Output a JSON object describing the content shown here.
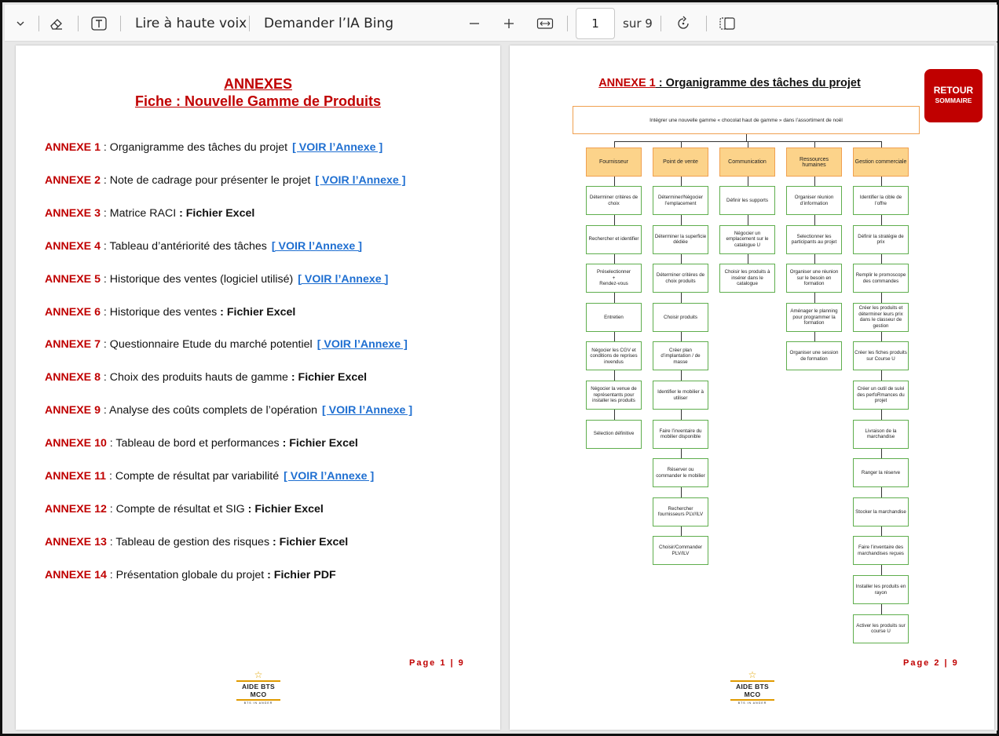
{
  "toolbar": {
    "read_aloud": "Lire à haute voix",
    "ask_ai": "Demander l’IA Bing",
    "page_current": "1",
    "page_total": "sur 9",
    "icons": [
      "chevron-down-icon",
      "eraser-icon",
      "text-icon",
      "zoom-out-icon",
      "zoom-in-icon",
      "fit-width-icon",
      "rotate-icon",
      "page-view-icon"
    ]
  },
  "page1": {
    "title": "ANNEXES",
    "subtitle": "Fiche : Nouvelle Gamme de Produits",
    "annexes": [
      {
        "id": "ANNEXE 1",
        "desc": " : Organigramme des tâches du projet",
        "bold": "",
        "link": "[ VOIR l’Annexe ]"
      },
      {
        "id": "ANNEXE 2",
        "desc": " : Note de cadrage pour présenter le projet",
        "bold": "",
        "link": "[ VOIR l’Annexe ]"
      },
      {
        "id": "ANNEXE 3",
        "desc": " : Matrice RACI ",
        "bold": ": Fichier Excel",
        "link": ""
      },
      {
        "id": "ANNEXE 4",
        "desc": " : Tableau d’antériorité des tâches",
        "bold": "",
        "link": "[ VOIR l’Annexe ]"
      },
      {
        "id": "ANNEXE 5",
        "desc": " : Historique des ventes (logiciel utilisé)",
        "bold": "",
        "link": "[ VOIR l’Annexe ]"
      },
      {
        "id": "ANNEXE 6",
        "desc": " : Historique des ventes ",
        "bold": ": Fichier Excel",
        "link": ""
      },
      {
        "id": "ANNEXE 7",
        "desc": " : Questionnaire Etude du marché potentiel",
        "bold": "",
        "link": "[ VOIR l’Annexe ]"
      },
      {
        "id": "ANNEXE 8",
        "desc": " : Choix des produits hauts de gamme ",
        "bold": ": Fichier Excel",
        "link": ""
      },
      {
        "id": "ANNEXE 9",
        "desc": " : Analyse des coûts complets de l’opération",
        "bold": "",
        "link": "[ VOIR l’Annexe ]"
      },
      {
        "id": "ANNEXE 10",
        "desc": " : Tableau de bord et performances ",
        "bold": ": Fichier Excel",
        "link": ""
      },
      {
        "id": "ANNEXE 11",
        "desc": " : Compte de résultat par variabilité",
        "bold": "",
        "link": "[ VOIR l’Annexe ]"
      },
      {
        "id": "ANNEXE 12",
        "desc": " : Compte de résultat et SIG ",
        "bold": ": Fichier Excel",
        "link": ""
      },
      {
        "id": "ANNEXE 13",
        "desc": " : Tableau de gestion des risques ",
        "bold": ": Fichier Excel",
        "link": ""
      },
      {
        "id": "ANNEXE 14",
        "desc": " : Présentation globale du projet ",
        "bold": ": Fichier PDF",
        "link": ""
      }
    ],
    "page_label": "Page 1 | 9",
    "logo_text": "AIDE BTS MCO",
    "logo_sub": "BTS IN ANGER"
  },
  "page2": {
    "title_id": "ANNEXE 1",
    "title_text": " : Organigramme des tâches du projet",
    "retour_1": "RETOUR",
    "retour_2": "SOMMAIRE",
    "root": "Intégrer une nouvelle gamme « chocolat haut de gamme » dans l’assortiment de noël",
    "columns": [
      {
        "head": "Fournisseur",
        "tasks": [
          "Déterminer critères de choix",
          "Rechercher et identifier",
          "Préselectionner\n+\nRendez-vous",
          "Entretien",
          "Négocier les CGV et conditions de reprises invendus",
          "Négocier la venue de représentants pour installer les produits",
          "Sélection définitive"
        ]
      },
      {
        "head": "Point de vente",
        "tasks": [
          "Déterminer/Négocier l’emplacement",
          "Déterminer la superficie dédiée",
          "Déterminer critères de choix produits",
          "Choisir produits",
          "Créer plan d’implantation / de masse",
          "Identifier le mobilier à utiliser",
          "Faire l’inventaire du mobilier disponible",
          "Réserver ou commander le mobilier",
          "Rechercher fournisseurs PLV/ILV",
          "Choisir/Commander PLV/ILV"
        ]
      },
      {
        "head": "Communication",
        "tasks": [
          "Définir les supports",
          "Négocier un emplacement sur le catalogue U",
          "Choisir les produits à insérer dans le catalogue"
        ]
      },
      {
        "head": "Ressources humaines",
        "tasks": [
          "Organiser réunion d’information",
          "Selectionner les participants au projet",
          "Organiser une réunion sur le besoin en formation",
          "Aménager le planning pour programmer la formation",
          "Organiser une session de formation"
        ]
      },
      {
        "head": "Gestion commerciale",
        "tasks": [
          "Identifier la cible de l’offre",
          "Définir la stratégie de prix",
          "Remplir le promoscope des commandes",
          "Créer les produits et déterminer leurs prix dans le classeur de gestion",
          "Créer les fiches produits sur Course U",
          "Créer un outil de suivi des perfoRmances du projet",
          "Livraison de la marchandise",
          "Ranger la réserve",
          "Stocker la marchandise",
          "Faire l’inventaire des marchandises reçues",
          "Installer les produits en rayon",
          "Activer les produits sur course U"
        ]
      }
    ],
    "page_label": "Page 2 | 9",
    "logo_text": "AIDE BTS MCO",
    "logo_sub": "BTS IN ANGER"
  }
}
